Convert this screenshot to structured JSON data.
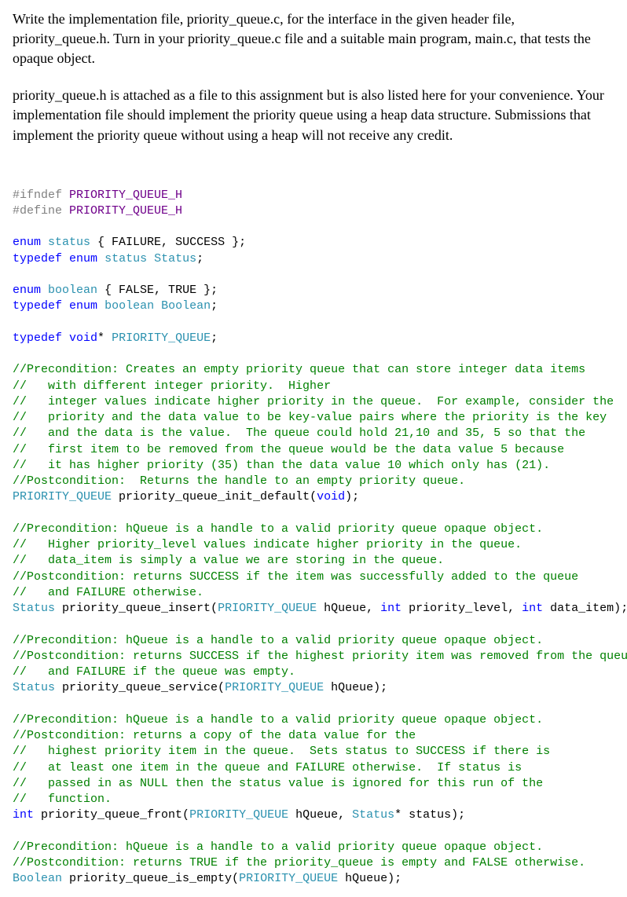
{
  "prose": {
    "p1": "Write the implementation file, priority_queue.c, for the interface in the given header file, priority_queue.h.  Turn in your priority_queue.c file and a suitable main program, main.c, that tests the opaque object.",
    "p2": "priority_queue.h is attached as a file to this assignment but is also listed here for your convenience.  Your implementation file should implement the priority queue using a heap data structure.  Submissions that implement the priority queue without using a heap will not receive any credit."
  },
  "code": {
    "ifndef": "#ifndef",
    "define": "#define",
    "guard": "PRIORITY_QUEUE_H",
    "enum_kw": "enum",
    "typedef_kw": "typedef",
    "void_kw": "void",
    "int_kw": "int",
    "status_name": "status",
    "Status_name": "Status",
    "status_body": " { FAILURE, SUCCESS };",
    "boolean_name": "boolean",
    "Boolean_name": "Boolean",
    "boolean_body": " { FALSE, TRUE };",
    "pq_type": "PRIORITY_QUEUE",
    "pq_typedef_tail": "* ",
    "c_init_1": "//Precondition: Creates an empty priority queue that can store integer data items",
    "c_init_2": "//   with different integer priority.  Higher",
    "c_init_3": "//   integer values indicate higher priority in the queue.  For example, consider the",
    "c_init_4": "//   priority and the data value to be key-value pairs where the priority is the key",
    "c_init_5": "//   and the data is the value.  The queue could hold 21,10 and 35, 5 so that the",
    "c_init_6": "//   first item to be removed from the queue would be the data value 5 because",
    "c_init_7": "//   it has higher priority (35) than the data value 10 which only has (21).",
    "c_init_8": "//Postcondition:  Returns the handle to an empty priority queue.",
    "fn_init": " priority_queue_init_default(",
    "fn_init_end": ");",
    "c_ins_1": "//Precondition: hQueue is a handle to a valid priority queue opaque object.",
    "c_ins_2": "//   Higher priority_level values indicate higher priority in the queue.",
    "c_ins_3": "//   data_item is simply a value we are storing in the queue.",
    "c_ins_4": "//Postcondition: returns SUCCESS if the item was successfully added to the queue",
    "c_ins_5": "//   and FAILURE otherwise.",
    "fn_ins_pre": " priority_queue_insert(",
    "fn_ins_mid1": " hQueue, ",
    "fn_ins_mid2": " priority_level, ",
    "fn_ins_end": " data_item);",
    "c_svc_1": "//Precondition: hQueue is a handle to a valid priority queue opaque object.",
    "c_svc_2": "//Postcondition: returns SUCCESS if the highest priority item was removed from the queue",
    "c_svc_3": "//   and FAILURE if the queue was empty.",
    "fn_svc_pre": " priority_queue_service(",
    "fn_svc_end": " hQueue);",
    "c_fr_1": "//Precondition: hQueue is a handle to a valid priority queue opaque object.",
    "c_fr_2": "//Postcondition: returns a copy of the data value for the",
    "c_fr_3": "//   highest priority item in the queue.  Sets status to SUCCESS if there is",
    "c_fr_4": "//   at least one item in the queue and FAILURE otherwise.  If status is",
    "c_fr_5": "//   passed in as NULL then the status value is ignored for this run of the",
    "c_fr_6": "//   function.",
    "fn_fr_pre": " priority_queue_front(",
    "fn_fr_mid": " hQueue, ",
    "fn_fr_end": "* status);",
    "c_emp_1": "//Precondition: hQueue is a handle to a valid priority queue opaque object.",
    "c_emp_2": "//Postcondition: returns TRUE if the priority_queue is empty and FALSE otherwise.",
    "fn_emp_pre": " priority_queue_is_empty(",
    "fn_emp_end": " hQueue);",
    "semi": ";"
  }
}
